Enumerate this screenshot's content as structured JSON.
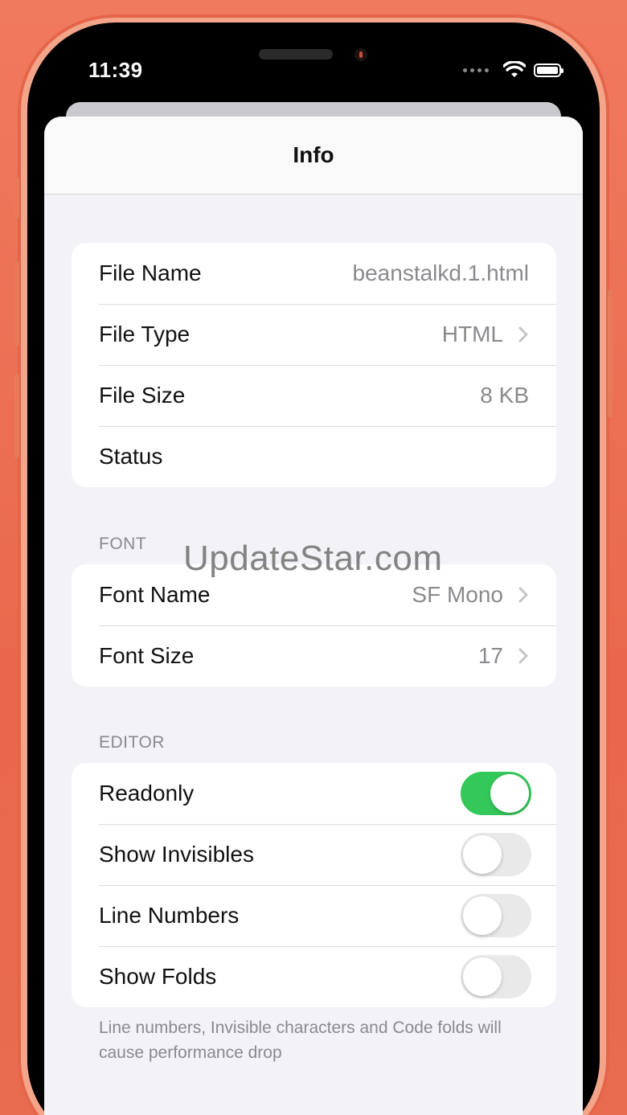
{
  "status_bar": {
    "time": "11:39"
  },
  "nav": {
    "title": "Info"
  },
  "file_group": [
    {
      "label": "File Name",
      "value": "beanstalkd.1.html",
      "chevron": false
    },
    {
      "label": "File Type",
      "value": "HTML",
      "chevron": true
    },
    {
      "label": "File Size",
      "value": "8 KB",
      "chevron": false
    },
    {
      "label": "Status",
      "value": "",
      "chevron": false
    }
  ],
  "font_section": {
    "header": "FONT",
    "rows": [
      {
        "label": "Font Name",
        "value": "SF Mono",
        "chevron": true
      },
      {
        "label": "Font Size",
        "value": "17",
        "chevron": true
      }
    ]
  },
  "editor_section": {
    "header": "EDITOR",
    "rows": [
      {
        "label": "Readonly",
        "on": true
      },
      {
        "label": "Show Invisibles",
        "on": false
      },
      {
        "label": "Line Numbers",
        "on": false
      },
      {
        "label": "Show Folds",
        "on": false
      }
    ],
    "footer": "Line numbers, Invisible characters and Code folds will cause performance drop"
  },
  "watermark": "UpdateStar.com",
  "colors": {
    "background": "#e9684d",
    "toggle_on": "#34c759",
    "toggle_off": "#e9e9ea",
    "secondary_text": "#8a8a8e"
  }
}
